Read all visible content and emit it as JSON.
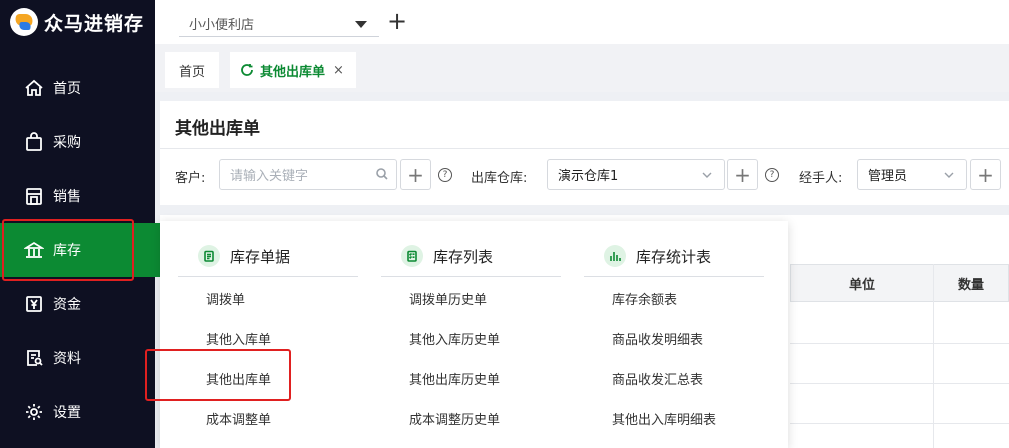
{
  "app": {
    "name": "众马进销存"
  },
  "sidebar": {
    "items": [
      {
        "label": "首页",
        "icon": "home-icon"
      },
      {
        "label": "采购",
        "icon": "shopping-bag-icon"
      },
      {
        "label": "销售",
        "icon": "store-icon"
      },
      {
        "label": "库存",
        "icon": "warehouse-icon",
        "active": true
      },
      {
        "label": "资金",
        "icon": "yen-icon"
      },
      {
        "label": "资料",
        "icon": "document-search-icon"
      },
      {
        "label": "设置",
        "icon": "gear-icon"
      }
    ]
  },
  "topbar": {
    "store": "小小便利店",
    "add_label": "+"
  },
  "tabs": [
    {
      "label": "首页"
    },
    {
      "label": "其他出库单",
      "active": true,
      "close": "×"
    }
  ],
  "page": {
    "title": "其他出库单",
    "filters": {
      "customer_label": "客户:",
      "customer_placeholder": "请输入关键字",
      "warehouse_label": "出库仓库:",
      "warehouse_value": "演示仓库1",
      "handler_label": "经手人:",
      "handler_value": "管理员",
      "plus": "+",
      "help": "?"
    },
    "table": {
      "columns": [
        "单位",
        "数量"
      ]
    }
  },
  "menu": {
    "columns": [
      {
        "title": "库存单据",
        "icon": "clipboard-icon",
        "items": [
          "调拨单",
          "其他入库单",
          "其他出库单",
          "成本调整单"
        ]
      },
      {
        "title": "库存列表",
        "icon": "checklist-icon",
        "items": [
          "调拨单历史单",
          "其他入库历史单",
          "其他出库历史单",
          "成本调整历史单"
        ]
      },
      {
        "title": "库存统计表",
        "icon": "bar-chart-icon",
        "items": [
          "库存余额表",
          "商品收发明细表",
          "商品收发汇总表",
          "其他出入库明细表"
        ]
      }
    ]
  },
  "colors": {
    "accent": "#0c8a33",
    "sidebar_bg": "#0e1022",
    "highlight": "#e02020"
  }
}
